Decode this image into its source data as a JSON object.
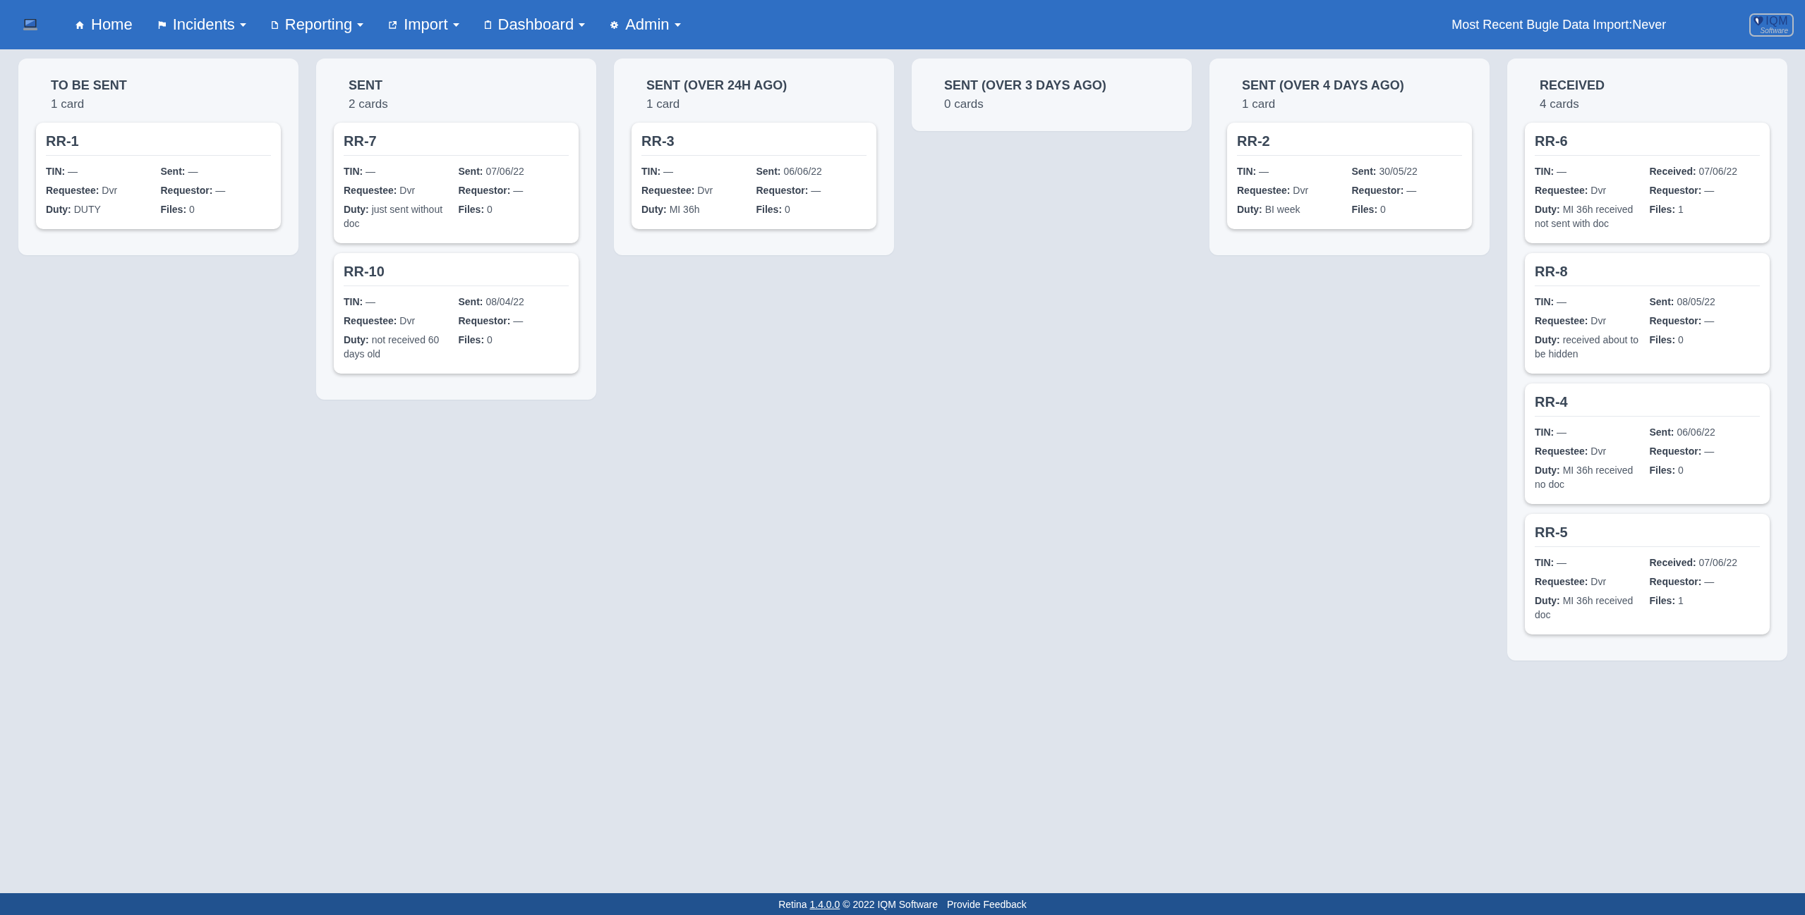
{
  "navbar": {
    "items": [
      {
        "label": "Home",
        "dropdown": false
      },
      {
        "label": "Incidents",
        "dropdown": true
      },
      {
        "label": "Reporting",
        "dropdown": true
      },
      {
        "label": "Import",
        "dropdown": true
      },
      {
        "label": "Dashboard",
        "dropdown": true
      },
      {
        "label": "Admin",
        "dropdown": true
      }
    ],
    "import_status": "Most Recent Bugle Data Import:Never",
    "logo": {
      "name": "IQM",
      "tagline": "Software"
    }
  },
  "columns": [
    {
      "title": "TO BE SENT",
      "count": "1 card",
      "cards": [
        {
          "title": "RR-1",
          "fields": [
            "**TIN:** —",
            "**Sent:** —",
            "**Requestee:** Dvr",
            "**Requestor:** —",
            "**Duty:** DUTY",
            "**Files:** 0"
          ]
        }
      ]
    },
    {
      "title": "SENT",
      "count": "2 cards",
      "cards": [
        {
          "title": "RR-7",
          "fields": [
            "**TIN:** —",
            "**Sent:** 07/06/22",
            "**Requestee:** Dvr",
            "**Requestor:** —",
            "**Duty:** just sent without doc",
            "**Files:** 0"
          ]
        },
        {
          "title": "RR-10",
          "fields": [
            "**TIN:** —",
            "**Sent:** 08/04/22",
            "**Requestee:** Dvr",
            "**Requestor:** —",
            "**Duty:** not received 60 days old",
            "**Files:** 0"
          ]
        }
      ]
    },
    {
      "title": "SENT (OVER 24H AGO)",
      "count": "1 card",
      "cards": [
        {
          "title": "RR-3",
          "fields": [
            "**TIN:** —",
            "**Sent:** 06/06/22",
            "**Requestee:** Dvr",
            "**Requestor:** —",
            "**Duty:** MI 36h",
            "**Files:** 0"
          ]
        }
      ]
    },
    {
      "title": "SENT (OVER 3 DAYS AGO)",
      "count": "0 cards"
    },
    {
      "title": "SENT (OVER 4 DAYS AGO)",
      "count": "1 card",
      "cards": [
        {
          "title": "RR-2",
          "fields": [
            "**TIN:** —",
            "**Sent:** 30/05/22",
            "**Requestee:** Dvr",
            "**Requestor:** —",
            "**Duty:** BI week",
            "**Files:** 0"
          ]
        }
      ]
    },
    {
      "title": "RECEIVED",
      "count": "4 cards",
      "cards": [
        {
          "title": "RR-6",
          "fields": [
            "**TIN:** —",
            "**Received:** 07/06/22",
            "**Requestee:** Dvr",
            "**Requestor:** —",
            "**Duty:** MI 36h received not sent with doc",
            "**Files:** 1"
          ]
        },
        {
          "title": "RR-8",
          "fields": [
            "**TIN:** —",
            "**Sent:** 08/05/22",
            "**Requestee:** Dvr",
            "**Requestor:** —",
            "**Duty:** received about to be hidden",
            "**Files:** 0"
          ]
        },
        {
          "title": "RR-4",
          "fields": [
            "**TIN:** —",
            "**Sent:** 06/06/22",
            "**Requestee:** Dvr",
            "**Requestor:** —",
            "**Duty:** MI 36h received no doc",
            "**Files:** 0"
          ]
        },
        {
          "title": "RR-5",
          "fields": [
            "**TIN:** —",
            "**Received:** 07/06/22",
            "**Requestee:** Dvr",
            "**Requestor:** —",
            "**Duty:** MI 36h received doc",
            "**Files:** 1"
          ]
        }
      ]
    }
  ],
  "footer": {
    "product": "Retina",
    "version": "1.4.0.0",
    "copyright": "© 2022 IQM Software",
    "feedback": "Provide Feedback"
  }
}
